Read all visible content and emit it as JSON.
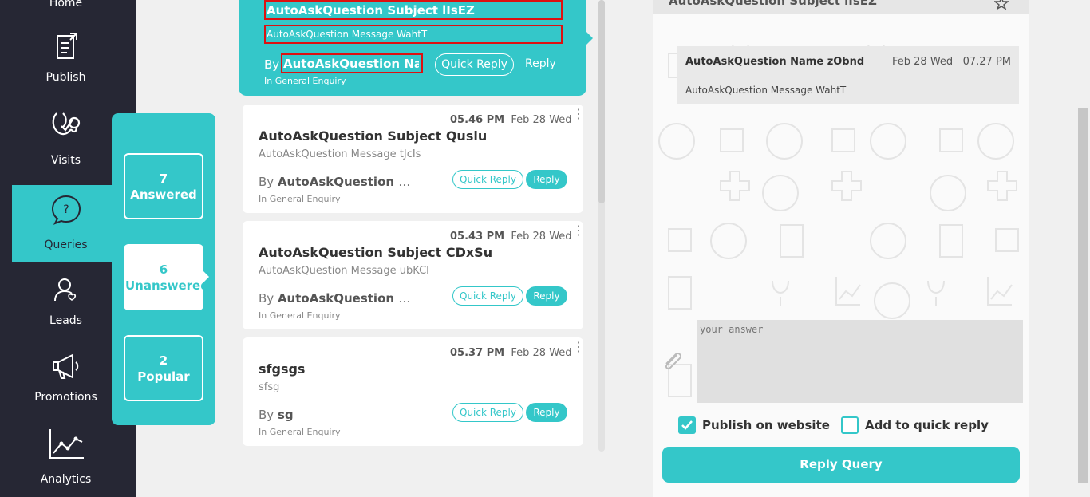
{
  "sidebar": {
    "items": [
      {
        "label": "Home",
        "icon": "home-icon"
      },
      {
        "label": "Publish",
        "icon": "publish-icon"
      },
      {
        "label": "Visits",
        "icon": "stethoscope-icon"
      },
      {
        "label": "Queries",
        "icon": "chat-question-icon"
      },
      {
        "label": "Leads",
        "icon": "leads-icon"
      },
      {
        "label": "Promotions",
        "icon": "megaphone-icon"
      },
      {
        "label": "Analytics",
        "icon": "chart-line-icon"
      }
    ],
    "active": "Queries"
  },
  "filters": [
    {
      "count": "7",
      "label": "Answered"
    },
    {
      "count": "6",
      "label": "Unanswered"
    },
    {
      "count": "2",
      "label": "Popular"
    }
  ],
  "selected_query": {
    "subject": "AutoAskQuestion Subject lIsEZ",
    "message": "AutoAskQuestion Message WahtT",
    "by_prefix": "By",
    "name": "AutoAskQuestion Na...",
    "quick_reply": "Quick Reply",
    "reply": "Reply",
    "category": "In General Enquiry"
  },
  "queries": [
    {
      "time": "05.46 PM",
      "date": "Feb 28 Wed",
      "subject": "AutoAskQuestion Subject Quslu",
      "message": "AutoAskQuestion Message tJcIs",
      "by_prefix": "By",
      "name": "AutoAskQuestion Na...",
      "quick_reply": "Quick Reply",
      "reply": "Reply",
      "category": "In General Enquiry"
    },
    {
      "time": "05.43 PM",
      "date": "Feb 28 Wed",
      "subject": "AutoAskQuestion Subject CDxSu",
      "message": "AutoAskQuestion Message ubKCl",
      "by_prefix": "By",
      "name": "AutoAskQuestion Na...",
      "quick_reply": "Quick Reply",
      "reply": "Reply",
      "category": "In General Enquiry"
    },
    {
      "time": "05.37 PM",
      "date": "Feb 28 Wed",
      "subject": "sfgsgs",
      "message": "sfsg",
      "by_prefix": "By",
      "name": "sg",
      "quick_reply": "Quick Reply",
      "reply": "Reply",
      "category": "In General Enquiry"
    }
  ],
  "detail": {
    "header": "AutoAskQuestion Subject lIsEZ",
    "bubble": {
      "name": "AutoAskQuestion Name zObnd",
      "date": "Feb 28 Wed",
      "time": "07.27 PM",
      "message": "AutoAskQuestion Message WahtT"
    },
    "answer_placeholder": "your answer",
    "publish_label": "Publish on website",
    "publish_checked": true,
    "quick_reply_label": "Add to quick reply",
    "quick_reply_checked": false,
    "submit_label": "Reply Query"
  },
  "colors": {
    "accent": "#34c7c9",
    "sidebar": "#262734",
    "highlight": "#dd1111"
  }
}
